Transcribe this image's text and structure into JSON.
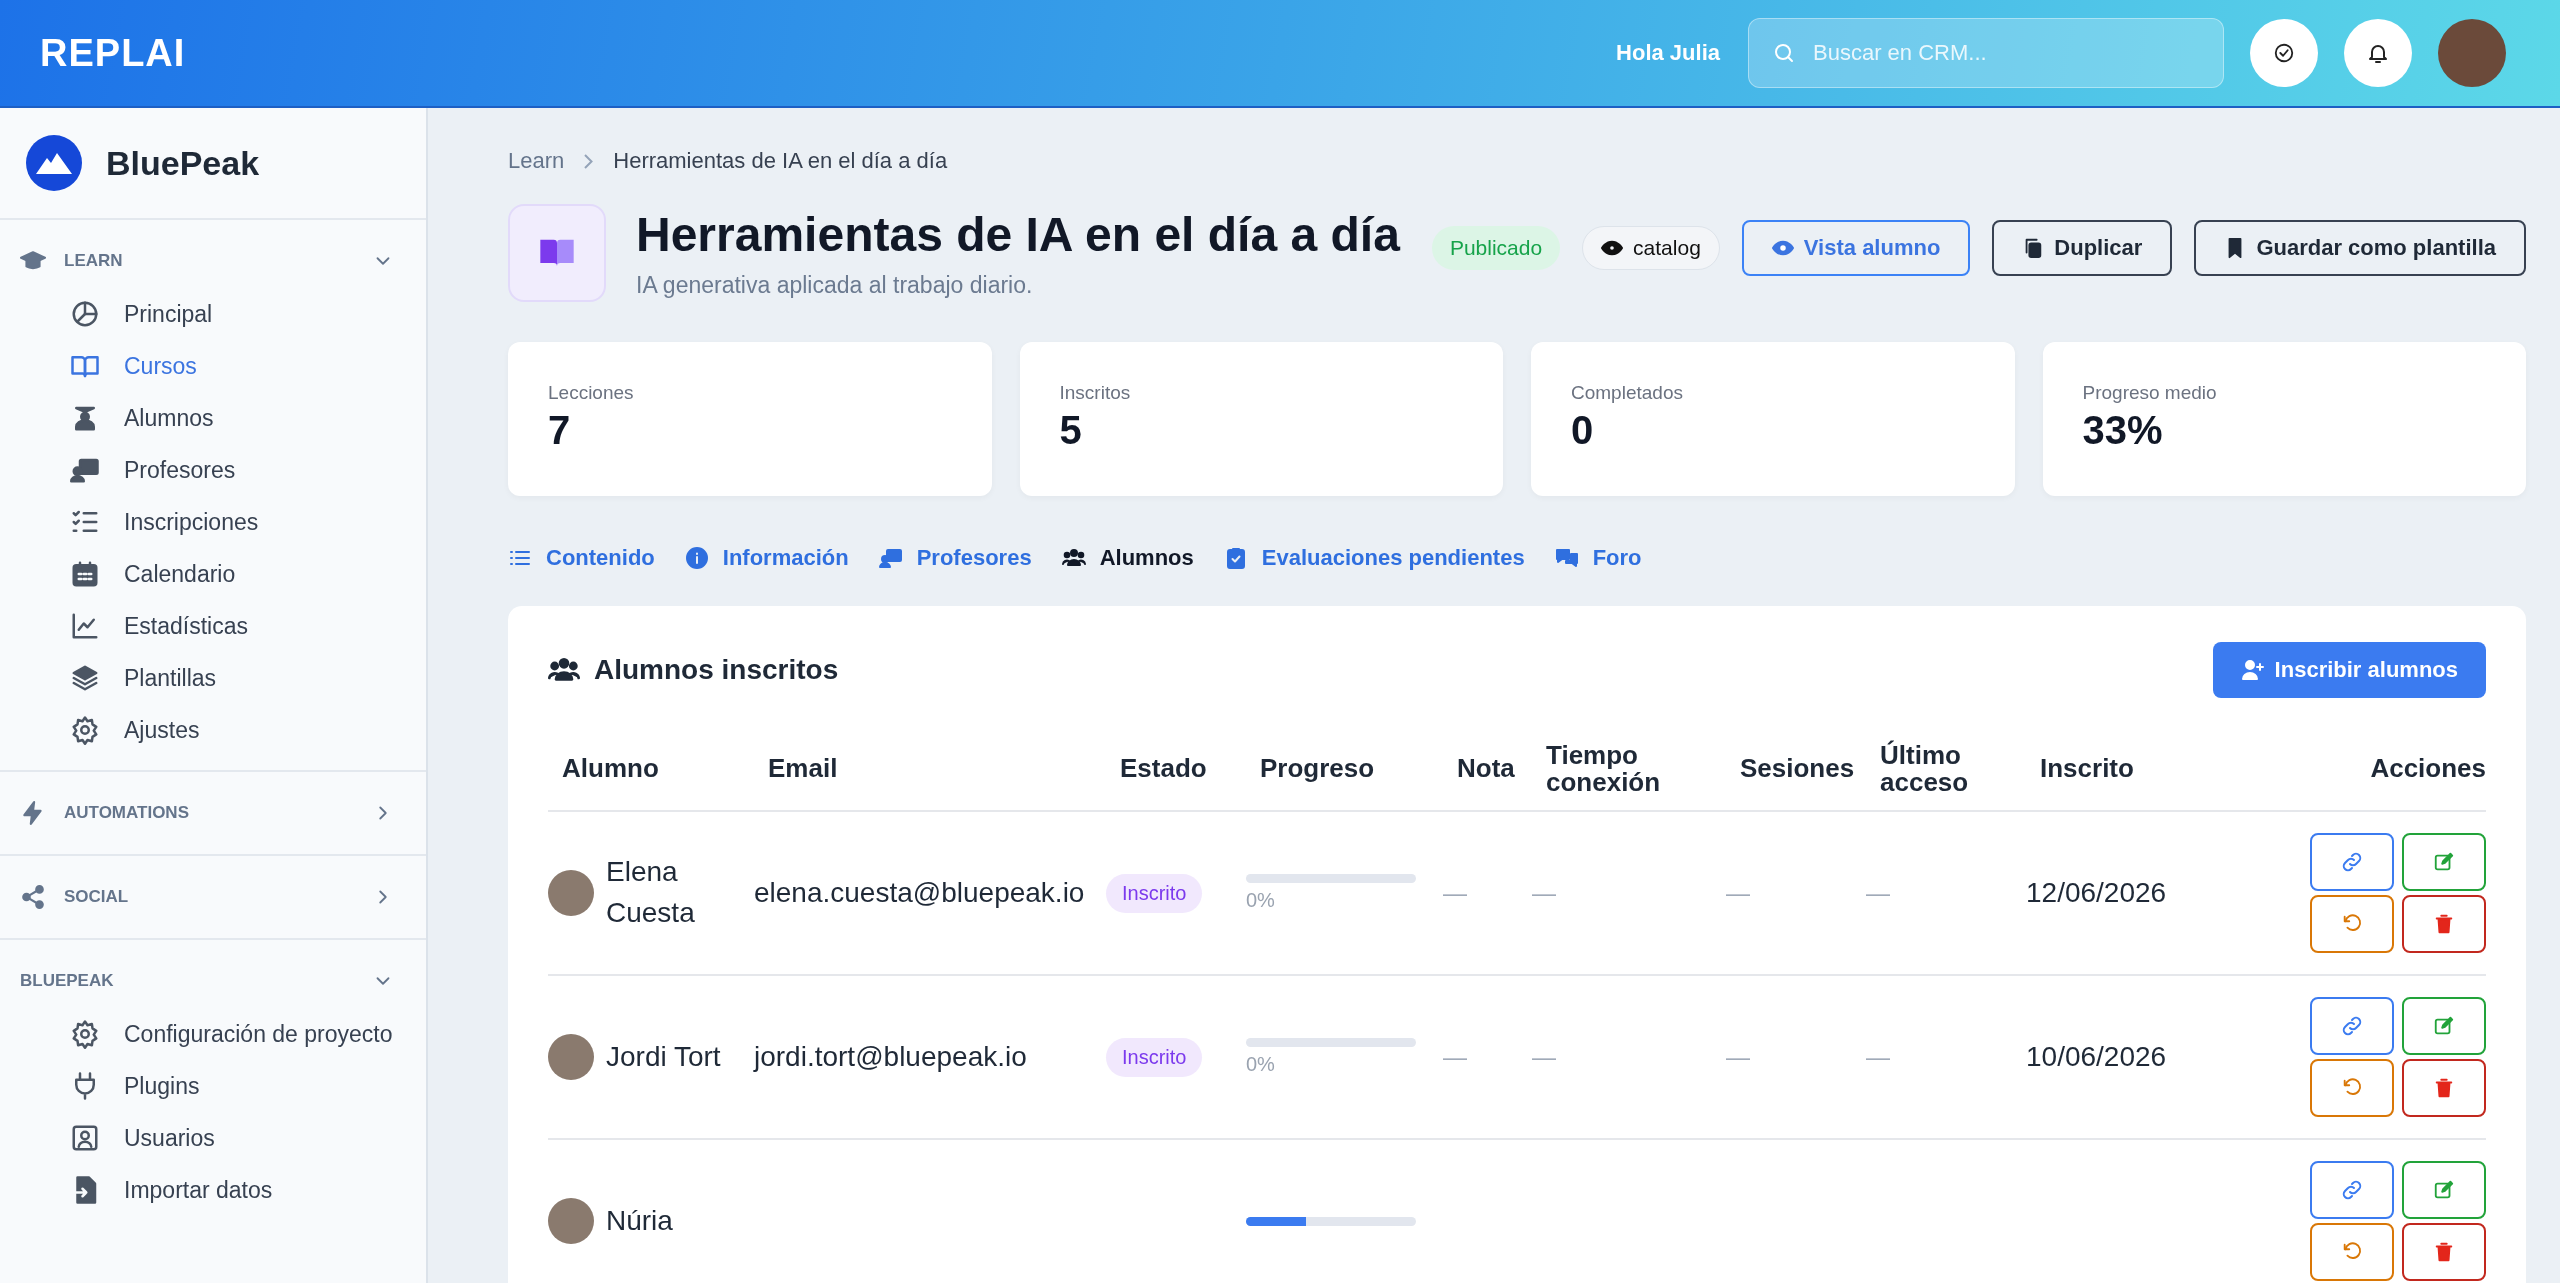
{
  "topbar": {
    "logo": "REPLAI",
    "greeting": "Hola Julia",
    "search": {
      "placeholder": "Buscar en CRM..."
    }
  },
  "sidebar": {
    "brand": "BluePeak",
    "sections": [
      {
        "label": "LEARN",
        "expanded": true,
        "items": [
          {
            "label": "Principal",
            "selected": false
          },
          {
            "label": "Cursos",
            "selected": true
          },
          {
            "label": "Alumnos",
            "selected": false
          },
          {
            "label": "Profesores",
            "selected": false
          },
          {
            "label": "Inscripciones",
            "selected": false
          },
          {
            "label": "Calendario",
            "selected": false
          },
          {
            "label": "Estadísticas",
            "selected": false
          },
          {
            "label": "Plantillas",
            "selected": false
          },
          {
            "label": "Ajustes",
            "selected": false
          }
        ]
      },
      {
        "label": "AUTOMATIONS",
        "expanded": false
      },
      {
        "label": "SOCIAL",
        "expanded": false
      },
      {
        "label": "BLUEPEAK",
        "expanded": true,
        "items": [
          {
            "label": "Configuración de proyecto",
            "selected": false
          },
          {
            "label": "Plugins",
            "selected": false
          },
          {
            "label": "Usuarios",
            "selected": false
          },
          {
            "label": "Importar datos",
            "selected": false
          }
        ]
      }
    ]
  },
  "breadcrumb": [
    "Learn",
    "Herramientas de IA en el día a día"
  ],
  "course": {
    "title": "Herramientas de IA en el día a día",
    "subtitle": "IA generativa aplicada al trabajo diario.",
    "status": "Publicado",
    "visibility": "catalog",
    "buttons": [
      {
        "label": "Vista alumno",
        "kind": "primary"
      },
      {
        "label": "Duplicar",
        "kind": "default"
      },
      {
        "label": "Guardar como plantilla",
        "kind": "default"
      }
    ]
  },
  "stats": [
    {
      "label": "Lecciones",
      "value": "7"
    },
    {
      "label": "Inscritos",
      "value": "5"
    },
    {
      "label": "Completados",
      "value": "0"
    },
    {
      "label": "Progreso medio",
      "value": "33%"
    }
  ],
  "tabs": [
    {
      "label": "Contenido",
      "selected": false
    },
    {
      "label": "Información",
      "selected": false
    },
    {
      "label": "Profesores",
      "selected": false
    },
    {
      "label": "Alumnos",
      "selected": true
    },
    {
      "label": "Evaluaciones pendientes",
      "selected": false
    },
    {
      "label": "Foro",
      "selected": false
    }
  ],
  "students": {
    "title": "Alumnos inscritos",
    "action": "Inscribir alumnos",
    "columns": [
      "Alumno",
      "Email",
      "Estado",
      "Progreso",
      "Nota",
      "Tiempo conexión",
      "Sesiones",
      "Último acceso",
      "Inscrito",
      "Acciones"
    ],
    "rows": [
      {
        "name": "Elena Cuesta",
        "email": "elena.cuesta@bluepeak.io",
        "status": "Inscrito",
        "level": 0,
        "progress": "0%",
        "grade": "—",
        "time": "—",
        "sessions": "—",
        "last_access": "—",
        "enrolled": "12/06/2026"
      },
      {
        "name": "Jordi Tort",
        "email": "jordi.tort@bluepeak.io",
        "status": "Inscrito",
        "level": 0,
        "progress": "0%",
        "grade": "—",
        "time": "—",
        "sessions": "—",
        "last_access": "—",
        "enrolled": "10/06/2026"
      },
      {
        "name": "Núria",
        "level": 0.35
      }
    ]
  }
}
